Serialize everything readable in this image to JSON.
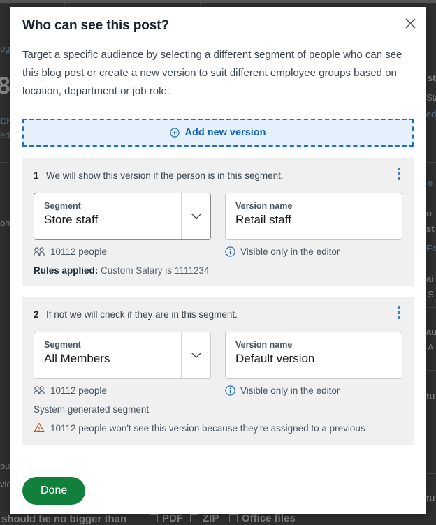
{
  "modal": {
    "title": "Who can see this post?",
    "description": "Target a specific audience by selecting a different segment of people who can see this blog post or create a new version to suit different employee groups based on location, department or job role.",
    "close_icon": "close-icon",
    "add_version": {
      "label": "Add new version",
      "icon": "plus-circle-icon"
    },
    "footer": {
      "done_label": "Done"
    }
  },
  "versions": [
    {
      "index": "1",
      "condition": "We will show this version if the person is in this segment.",
      "menu_icon": "kebab-menu-icon",
      "segment": {
        "label": "Segment",
        "value": "Store staff",
        "caret_icon": "chevron-down-icon",
        "focused": true
      },
      "version_name": {
        "label": "Version name",
        "value": "Retail staff"
      },
      "people": {
        "icon": "people-icon",
        "text": "10112 people"
      },
      "visibility": {
        "icon": "info-icon",
        "text": "Visible only in the editor"
      },
      "rules": {
        "label": "Rules applied:",
        "value": "Custom Salary is 1111234"
      }
    },
    {
      "index": "2",
      "condition": "If not we will check if they are in this segment.",
      "menu_icon": "kebab-menu-icon",
      "segment": {
        "label": "Segment",
        "value": "All Members",
        "caret_icon": "chevron-down-icon",
        "focused": false
      },
      "version_name": {
        "label": "Version name",
        "value": "Default version"
      },
      "people": {
        "icon": "people-icon",
        "text": "10112 people"
      },
      "visibility": {
        "icon": "info-icon",
        "text": "Visible only in the editor"
      },
      "system_note": "System generated segment",
      "warning": {
        "icon": "warning-triangle-icon",
        "text": "10112 people won't see this version because they're assigned to a previous"
      }
    }
  ],
  "background": {
    "fragments": [
      "og",
      "8",
      "Chi",
      "ed",
      "on",
      "bu",
      "vic",
      "should be no bigger than",
      "st",
      "Sta",
      "ed",
      "e",
      "o",
      "st",
      "Ed",
      "ai",
      "S",
      "au",
      "A",
      "tu",
      "tu",
      "PDF",
      "ZIP",
      "Office files"
    ]
  },
  "colors": {
    "accent_blue": "#1763b8",
    "add_bg": "#e4f0fb",
    "card_bg": "#f0f0f0",
    "done_green": "#12803d",
    "warning_orange": "#c4561e",
    "info_blue": "#1763b8"
  }
}
